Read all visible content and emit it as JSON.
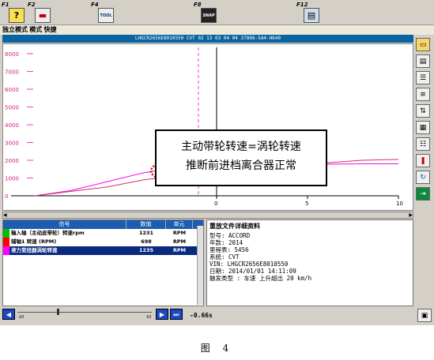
{
  "toolbar": {
    "keys": [
      {
        "label": "F1",
        "icon": "help-icon"
      },
      {
        "label": "F2",
        "icon": "car-icon"
      },
      {
        "label": "F4",
        "icon": "tool-icon",
        "text": "TOOL"
      },
      {
        "label": "F8",
        "icon": "camera-icon",
        "text": "SNAP"
      },
      {
        "label": "F12",
        "icon": "printer-icon"
      }
    ]
  },
  "menu": {
    "text": "独立模式 模式 快捷"
  },
  "title": "LHGCR2656E8010550  CVT  02 13 03 04 04  37806-5A4-H640",
  "chart_data": {
    "type": "line",
    "title": "",
    "ylim": [
      0,
      8000
    ],
    "xlim": [
      -10,
      10
    ],
    "yticks": [
      "8000",
      "7000",
      "6000",
      "5000",
      "4000",
      "3000",
      "2000",
      "1000",
      "0"
    ],
    "xticks": [
      "0",
      "5",
      "10"
    ],
    "series": [
      {
        "color": "#ff00ff",
        "x": [
          -10,
          -8,
          -6,
          -4,
          -3,
          -2,
          -1,
          0,
          2,
          4,
          6,
          8,
          10
        ],
        "values": [
          0,
          300,
          800,
          1300,
          1450,
          1400,
          1450,
          1500,
          1700,
          1750,
          1780,
          1800,
          1800
        ]
      },
      {
        "color": "#cc3366",
        "x": [
          -10,
          -6,
          -4,
          -2,
          0,
          4,
          8,
          10
        ],
        "values": [
          0,
          500,
          900,
          1150,
          1250,
          1700,
          2000,
          2050
        ]
      }
    ],
    "cursor_x": -1,
    "annotation": {
      "line1": "主动带轮转速=涡轮转速",
      "line2": "推断前进档离合器正常"
    }
  },
  "table": {
    "headers": [
      "信号",
      "数值",
      "单元"
    ],
    "rows": [
      {
        "swatch": "#00c000",
        "name": "输入轴（主动皮带轮）转速rpm",
        "value": "1231",
        "unit": "RPM"
      },
      {
        "swatch": "#ff0000",
        "name": "辅轴1 转速 (RPM)",
        "value": "698",
        "unit": "RPM"
      },
      {
        "swatch": "#ff00ff",
        "name": "液力变扭器涡轮转速",
        "value": "1235",
        "unit": "RPM"
      }
    ]
  },
  "info": {
    "title": "重放文件详细资料",
    "lines": [
      "型号: ACCORD",
      "年款: 2014",
      "里程表:  5456",
      "系统: CVT",
      "VIN: LHGCR2656E8010550",
      "日期: 2014/01/01 14:11:09",
      "触发类型 : 车速 上升超出 20 km/h"
    ]
  },
  "playbar": {
    "time": "-0.66s",
    "scale_left": "-10",
    "scale_right": "10"
  },
  "caption": "图 4"
}
